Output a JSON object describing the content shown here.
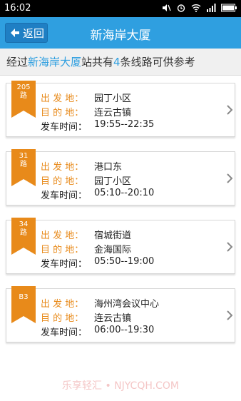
{
  "status_bar": {
    "time": "16:02",
    "icons": [
      "mute-icon",
      "alarm-icon",
      "wifi-icon",
      "signal-icon",
      "battery-icon"
    ]
  },
  "header": {
    "back_label": "返回",
    "title": "新海岸大厦"
  },
  "summary": {
    "prefix": "经过",
    "station": "新海岸大厦",
    "middle": "站共有",
    "count": "4",
    "suffix": "条线路可供参考"
  },
  "labels": {
    "from": "出 发 地：",
    "to": "目 的 地：",
    "time": "发车时间："
  },
  "routes": [
    {
      "line": "205",
      "unit": "路",
      "from": "园丁小区",
      "to": "连云古镇",
      "time": "19:55--22:35"
    },
    {
      "line": "31",
      "unit": "路",
      "from": "港口东",
      "to": "园丁小区",
      "time": "05:10--20:10"
    },
    {
      "line": "34",
      "unit": "路",
      "from": "宿城街道",
      "to": "金海国际",
      "time": "05:50--19:00"
    },
    {
      "line": "B3",
      "unit": "",
      "from": "海州湾会议中心",
      "to": "连云古镇",
      "time": "06:00--19:30"
    }
  ],
  "watermark": "乐享轻汇 • NJYCQH.COM",
  "colors": {
    "header": "#2f9fe0",
    "accent": "#e88a1a",
    "highlight": "#2f9fe0"
  }
}
